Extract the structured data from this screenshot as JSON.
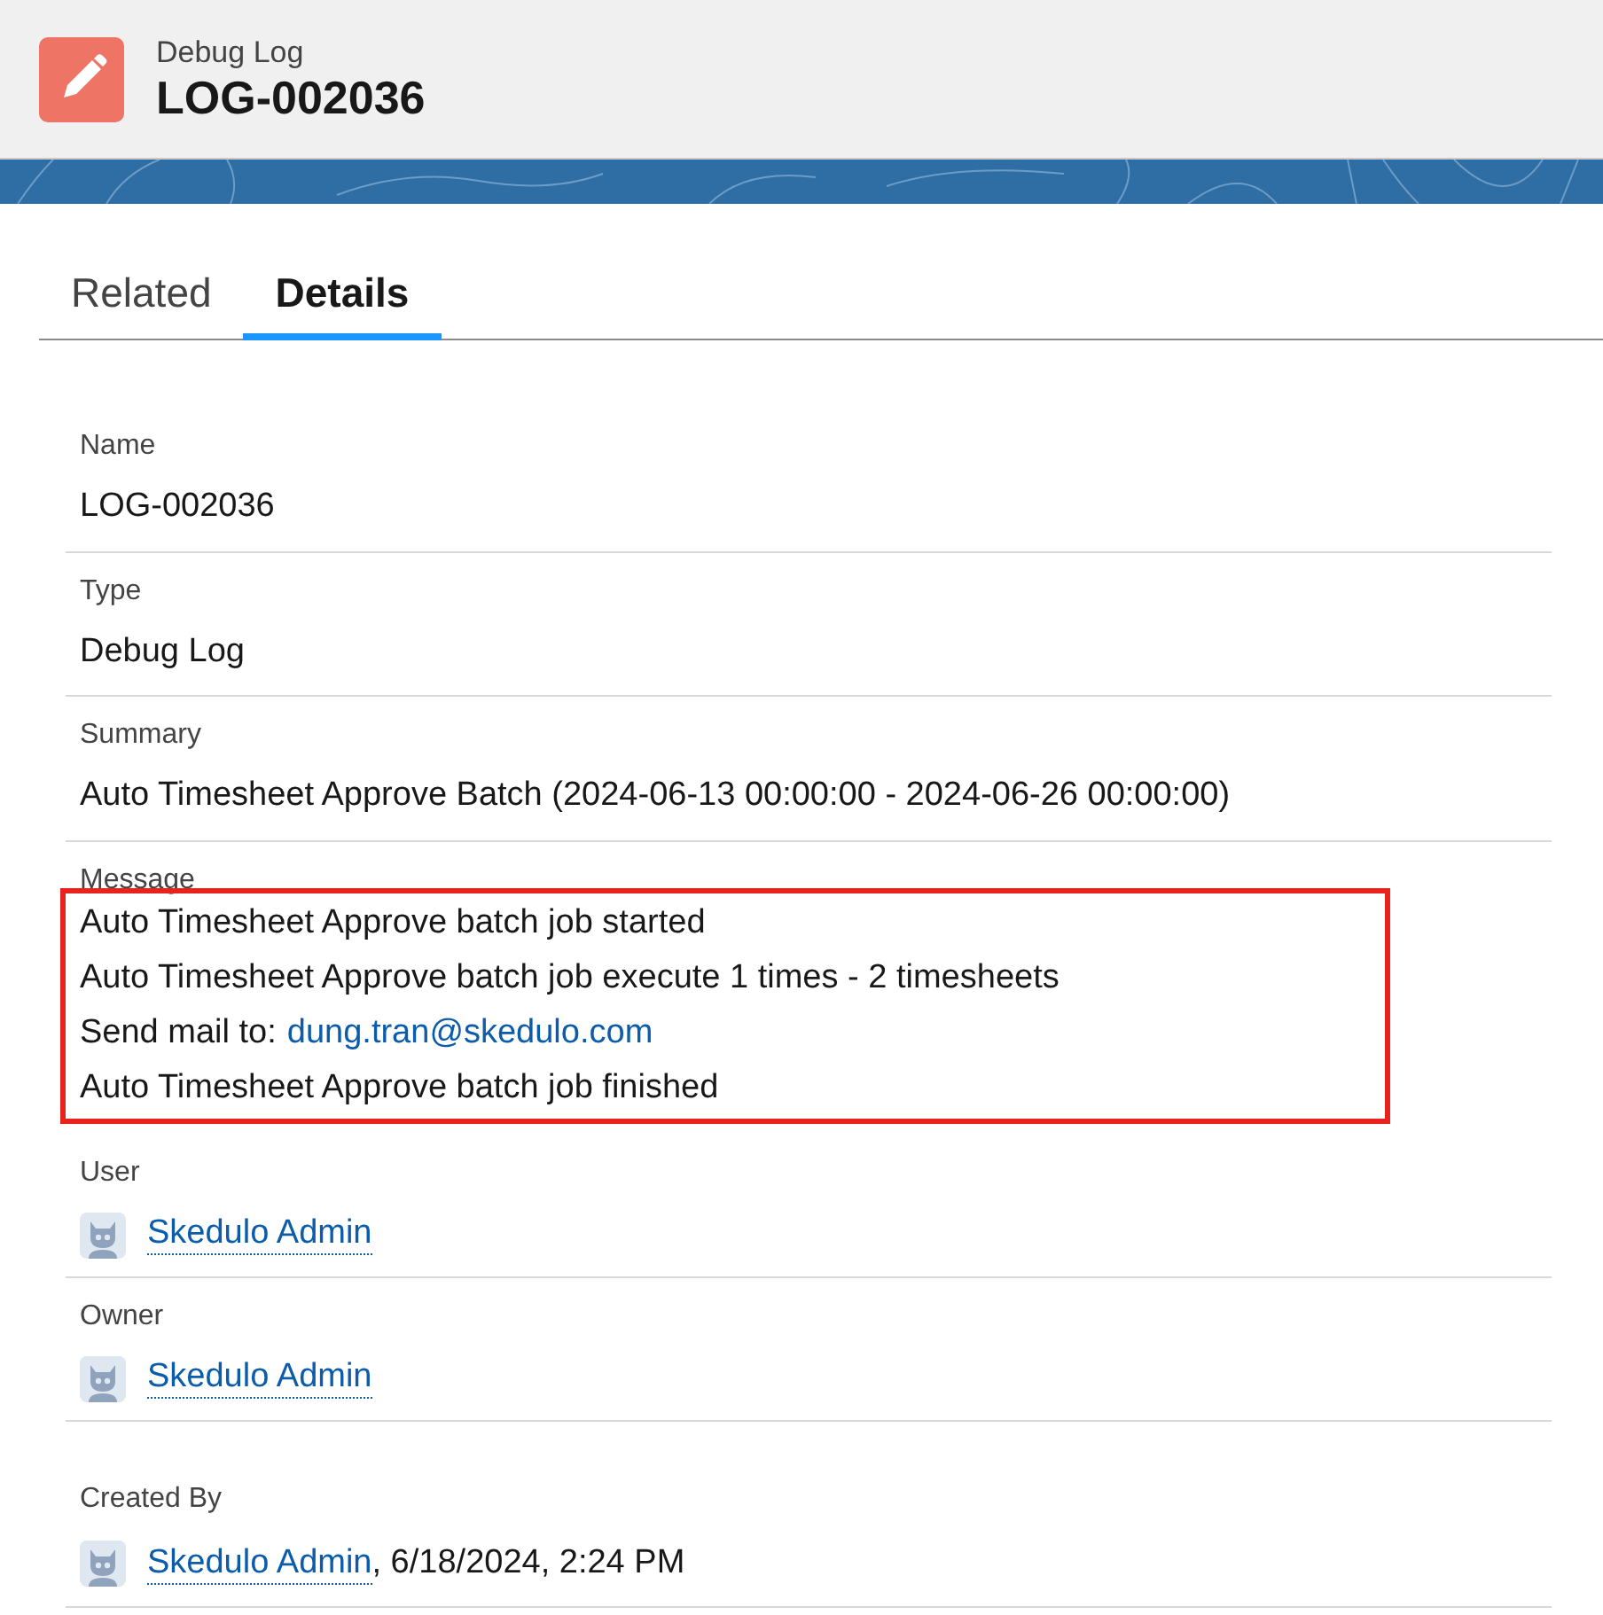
{
  "header": {
    "object_type": "Debug Log",
    "title": "LOG-002036"
  },
  "tabs": [
    {
      "label": "Related",
      "selected": false
    },
    {
      "label": "Details",
      "selected": true
    }
  ],
  "fields": [
    {
      "kind": "text",
      "label": "Name",
      "value": "LOG-002036"
    },
    {
      "kind": "text",
      "label": "Type",
      "value": "Debug Log"
    },
    {
      "kind": "text",
      "label": "Summary",
      "value": "Auto Timesheet Approve Batch (2024-06-13 00:00:00 - 2024-06-26 00:00:00)"
    },
    {
      "kind": "message",
      "label": "Message",
      "highlighted": true,
      "lines": [
        {
          "text": "Auto Timesheet Approve batch job started"
        },
        {
          "text": "Auto Timesheet Approve batch job execute 1 times - 2 timesheets"
        },
        {
          "text": "Send mail to:",
          "link": "dung.tran@skedulo.com"
        },
        {
          "text": "Auto Timesheet Approve batch job finished"
        }
      ]
    },
    {
      "kind": "user",
      "label": "User",
      "user": "Skedulo Admin"
    },
    {
      "kind": "user",
      "label": "Owner",
      "user": "Skedulo Admin"
    },
    {
      "kind": "user",
      "label": "Created By",
      "user": "Skedulo Admin",
      "suffix": ", 6/18/2024, 2:24 PM",
      "spaced": true
    }
  ]
}
